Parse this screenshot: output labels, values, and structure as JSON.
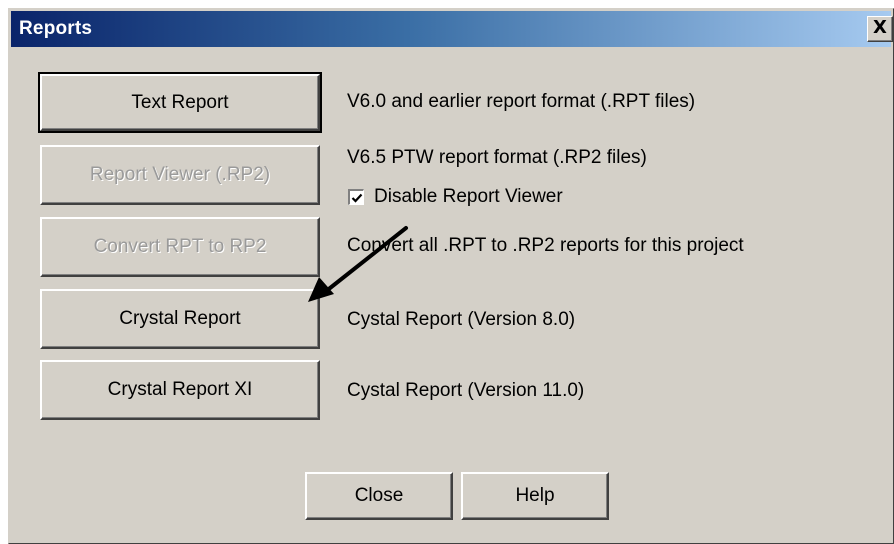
{
  "window": {
    "title": "Reports",
    "close_glyph": "X"
  },
  "buttons": {
    "text_report": "Text Report",
    "report_viewer": "Report Viewer (.RP2)",
    "convert_rpt": "Convert RPT to RP2",
    "crystal_report": "Crystal Report",
    "crystal_report_xi": "Crystal Report XI",
    "close": "Close",
    "help": "Help"
  },
  "descriptions": {
    "text_report": "V6.0 and earlier report format (.RPT files)",
    "report_viewer": "V6.5 PTW report format (.RP2 files)",
    "convert_rpt": "Convert all .RPT to .RP2 reports for this project",
    "crystal_report": "Cystal Report (Version 8.0)",
    "crystal_report_xi": "Cystal Report (Version 11.0)"
  },
  "checkbox": {
    "label": "Disable Report Viewer",
    "checked": true
  },
  "annotation": {
    "icon": "arrow-pointer-icon",
    "color": "#000000"
  },
  "colors": {
    "titlebar_start": "#0a246a",
    "titlebar_end": "#a6caf0",
    "face": "#d4d0c8",
    "disabled_text": "#9a9a9a"
  }
}
